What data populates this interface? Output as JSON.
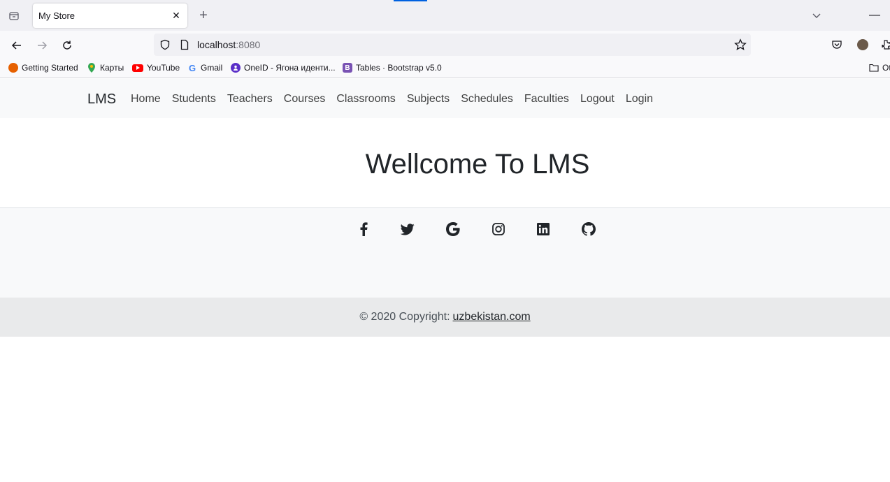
{
  "browser": {
    "tab_title": "My Store",
    "url_host": "localhost",
    "url_port": ":8080",
    "bookmarks": [
      {
        "label": "Getting Started",
        "icon": "firefox-icon",
        "color": "#e66000"
      },
      {
        "label": "Карты",
        "icon": "maps-pin-icon",
        "color": "#34a853"
      },
      {
        "label": "YouTube",
        "icon": "youtube-icon",
        "color": "#ff0000"
      },
      {
        "label": "Gmail",
        "icon": "google-icon",
        "color": "#4285f4"
      },
      {
        "label": "OneID - Ягона иденти...",
        "icon": "oneid-icon",
        "color": "#5a2ec8"
      },
      {
        "label": "Tables · Bootstrap v5.0",
        "icon": "bootstrap-icon",
        "color": "#7952b3"
      },
      {
        "label": "Ot",
        "icon": "folder-icon",
        "color": "#15141a"
      }
    ]
  },
  "site": {
    "brand": "LMS",
    "nav": [
      "Home",
      "Students",
      "Teachers",
      "Courses",
      "Classrooms",
      "Subjects",
      "Schedules",
      "Faculties",
      "Logout",
      "Login"
    ],
    "heading": "Wellcome To LMS",
    "social": [
      "facebook-icon",
      "twitter-icon",
      "google-icon",
      "instagram-icon",
      "linkedin-icon",
      "github-icon"
    ],
    "copyright_text": "© 2020 Copyright:",
    "copyright_link": "uzbekistan.com"
  }
}
